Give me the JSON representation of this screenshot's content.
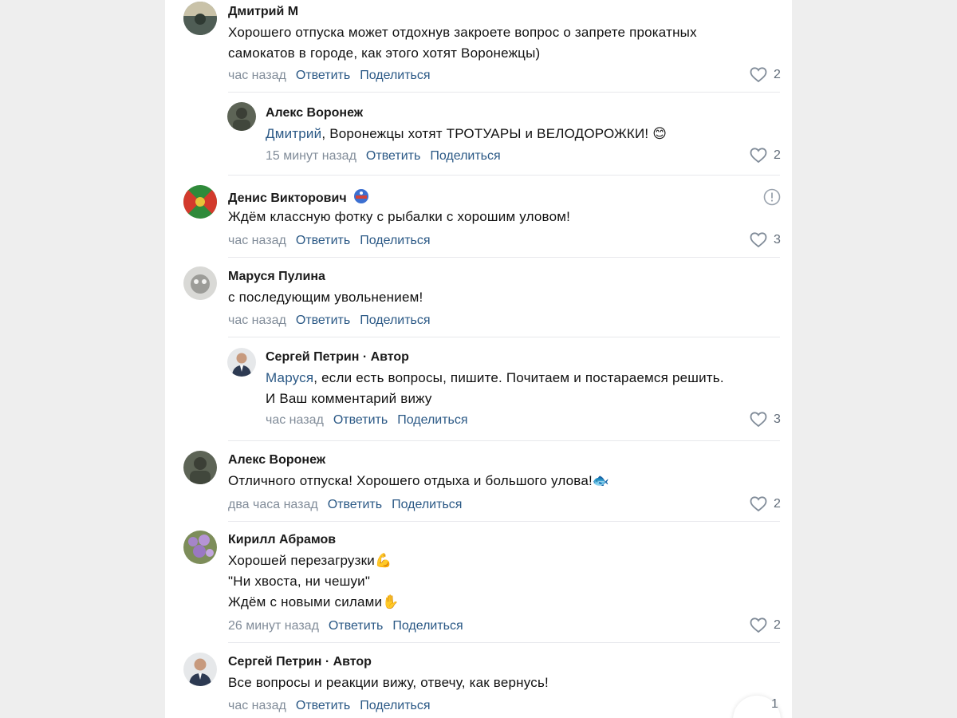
{
  "colors": {
    "link": "#2a5885",
    "meta": "#818c99",
    "divider": "#e7e8ec"
  },
  "actions": {
    "reply": "Ответить",
    "share": "Поделиться"
  },
  "comments": [
    {
      "author": "Дмитрий М",
      "text_lines": [
        "Хорошего отпуска может отдохнув закроете вопрос о запрете прокатных",
        "самокатов в городе, как этого хотят Воронежцы)"
      ],
      "time": "час назад",
      "likes": "2"
    },
    {
      "author": "Алекс Воронеж",
      "mention": "Дмитрий",
      "text": ", Воронежцы хотят ТРОТУАРЫ и ВЕЛОДОРОЖКИ! 😊",
      "time": "15 минут назад",
      "likes": "2"
    },
    {
      "author": "Денис Викторович",
      "author_icon": "helmet-emoji",
      "text": "Ждём классную фотку с рыбалки с хорошим уловом!",
      "time": "час назад",
      "likes": "3",
      "report_icon": "alert-circle-icon"
    },
    {
      "author": "Маруся Пулина",
      "text": "с последующим увольнением!",
      "time": "час назад"
    },
    {
      "author": "Сергей Петрин · Автор",
      "mention": "Маруся",
      "text": ", если есть вопросы, пишите. Почитаем и постараемся решить.",
      "text_line2": "И Ваш комментарий вижу",
      "time": "час назад",
      "likes": "3"
    },
    {
      "author": "Алекс Воронеж",
      "text": "Отличного отпуска! Хорошего отдыха и большого улова!🐟",
      "time": "два часа назад",
      "likes": "2"
    },
    {
      "author": "Кирилл Абрамов",
      "text_lines": [
        "Хорошей перезагрузки💪",
        "\"Ни хвоста, ни чешуи\"",
        "Ждём с новыми силами✋"
      ],
      "time": "26 минут назад",
      "likes": "2"
    },
    {
      "author": "Сергей Петрин · Автор",
      "text": "Все вопросы и реакции вижу, отвечу, как вернусь!",
      "time": "час назад",
      "likes": "1"
    }
  ]
}
